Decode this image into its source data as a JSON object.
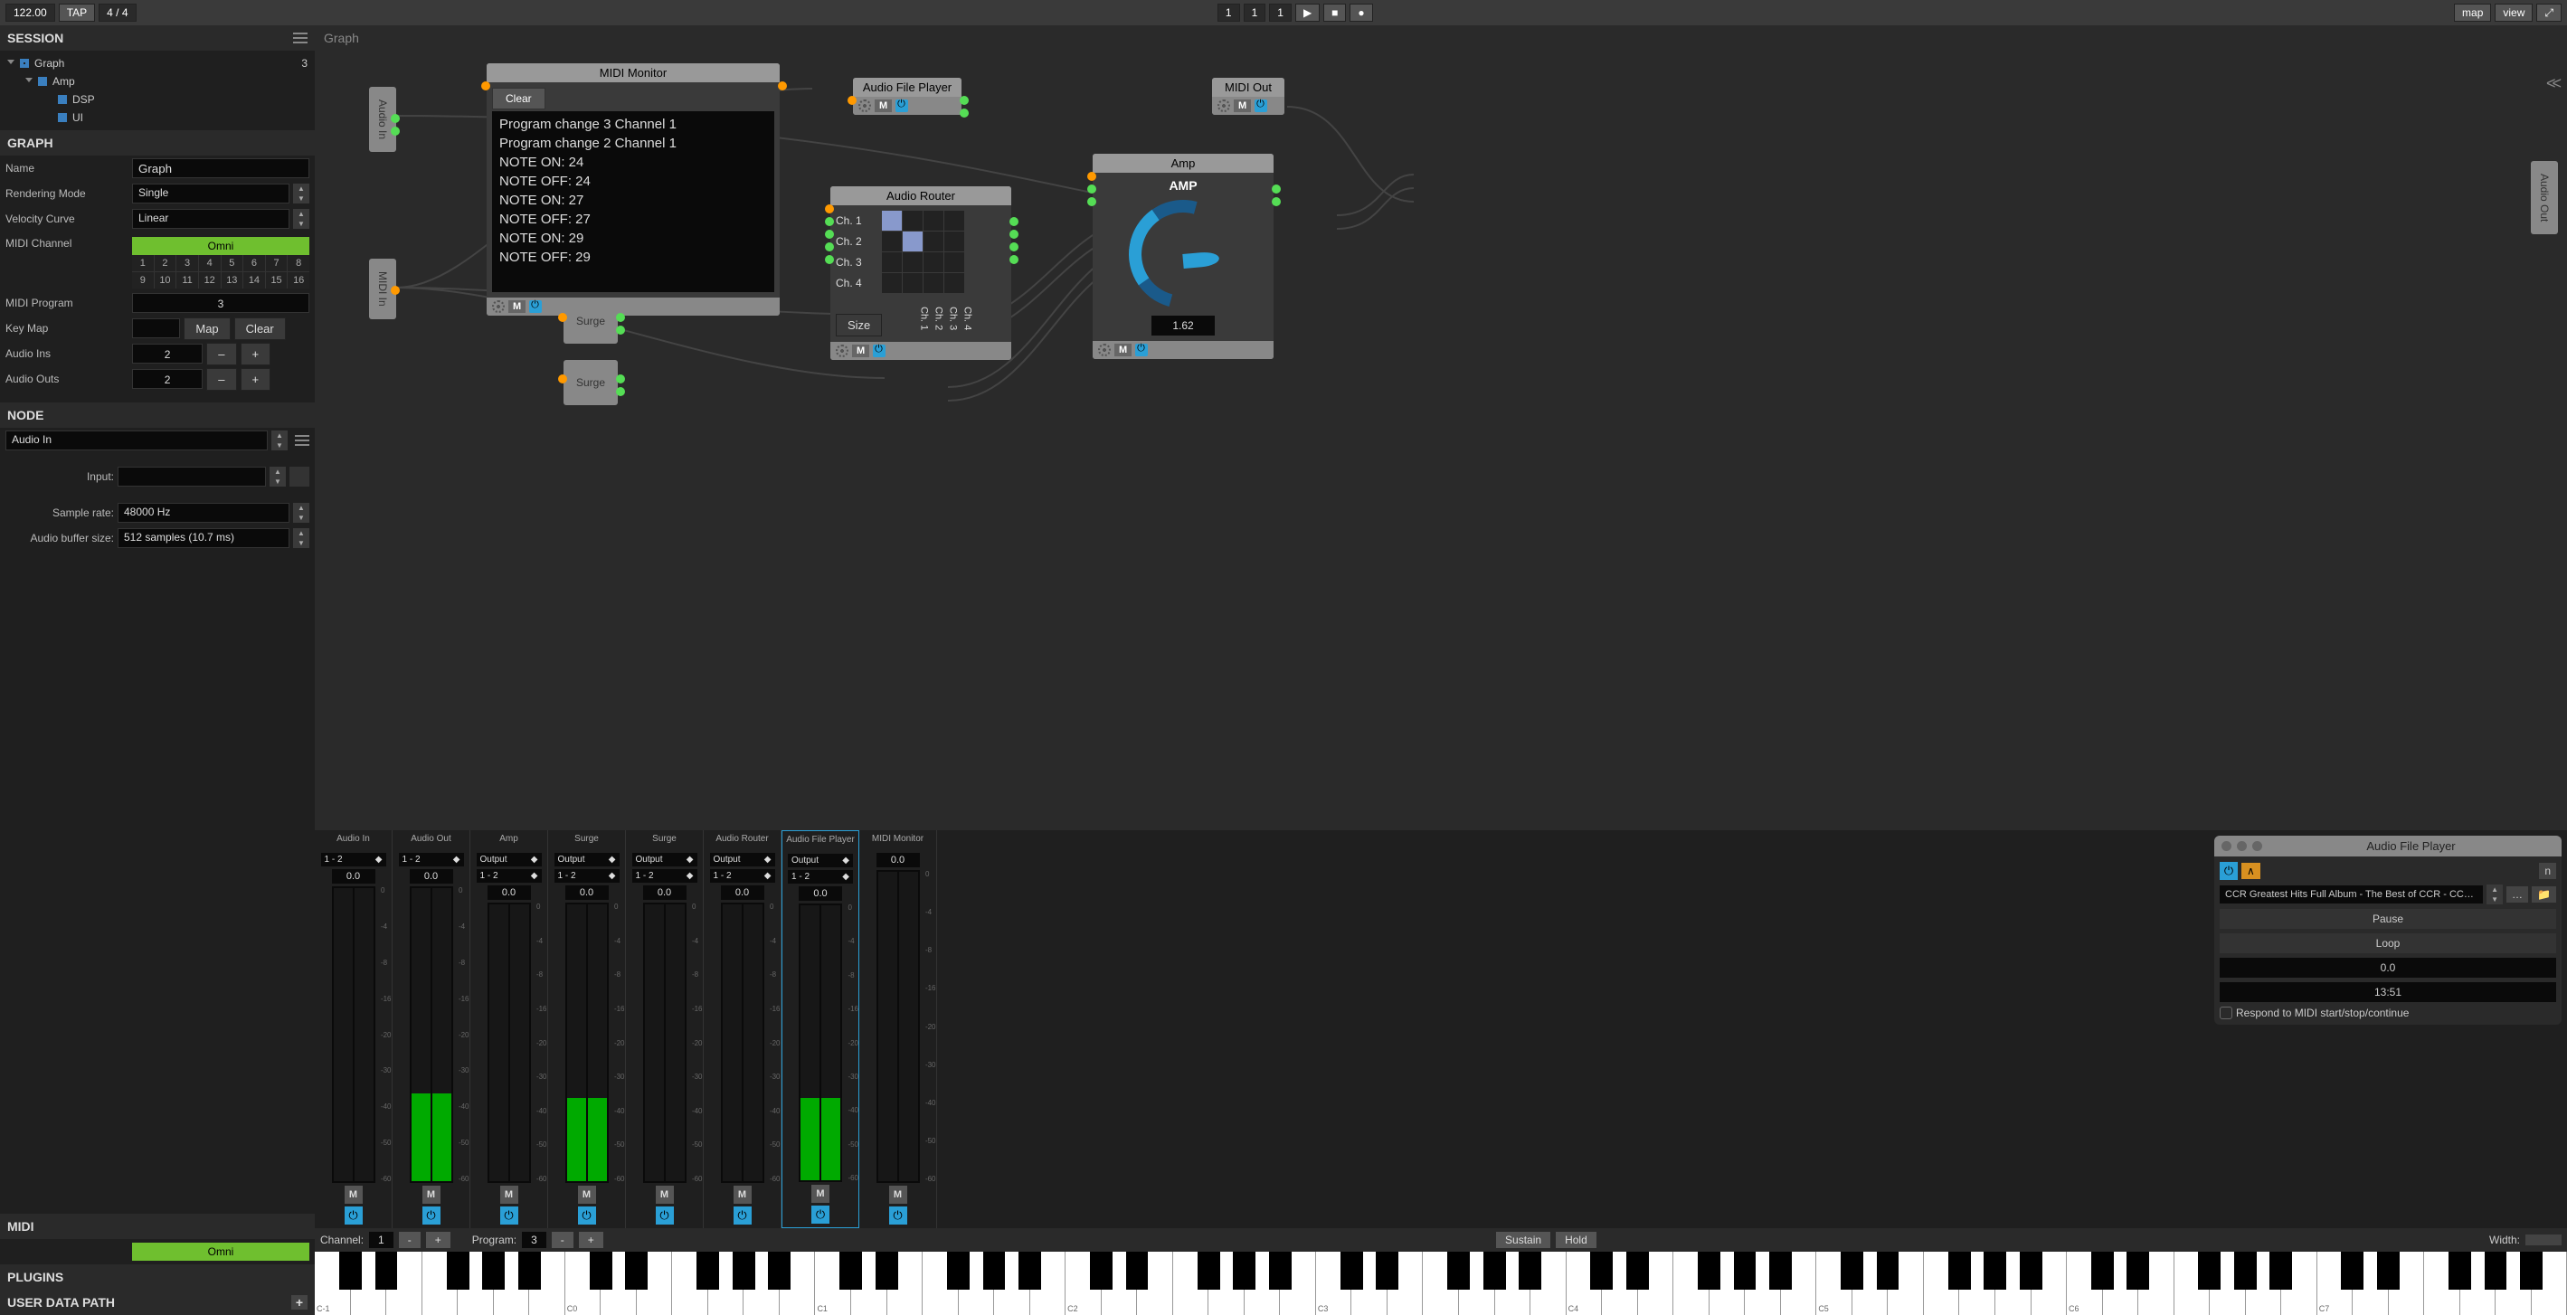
{
  "toolbar": {
    "tempo": "122.00",
    "tap": "TAP",
    "timesig": "4 / 4",
    "transport": [
      "1",
      "1",
      "1"
    ],
    "map": "map",
    "view": "view"
  },
  "session": {
    "header": "SESSION",
    "tree": [
      {
        "label": "Graph",
        "count": "3",
        "indent": 0,
        "icon": "grid"
      },
      {
        "label": "Amp",
        "indent": 1,
        "icon": "solid"
      },
      {
        "label": "DSP",
        "indent": 2,
        "icon": "solid"
      },
      {
        "label": "UI",
        "indent": 2,
        "icon": "solid"
      }
    ]
  },
  "graph_props": {
    "header": "GRAPH",
    "name_lbl": "Name",
    "name": "Graph",
    "render_lbl": "Rendering Mode",
    "render": "Single",
    "vel_lbl": "Velocity Curve",
    "vel": "Linear",
    "midich_lbl": "MIDI Channel",
    "omni": "Omni",
    "channels": [
      "1",
      "2",
      "3",
      "4",
      "5",
      "6",
      "7",
      "8",
      "9",
      "10",
      "11",
      "12",
      "13",
      "14",
      "15",
      "16"
    ],
    "midip_lbl": "MIDI Program",
    "midip": "3",
    "keymap_lbl": "Key Map",
    "map_btn": "Map",
    "clear_btn": "Clear",
    "ains_lbl": "Audio Ins",
    "ains": "2",
    "aouts_lbl": "Audio Outs",
    "aouts": "2",
    "minus": "–",
    "plus": "+"
  },
  "node_props": {
    "header": "NODE",
    "selected": "Audio In",
    "input_lbl": "Input:",
    "sr_lbl": "Sample rate:",
    "sr": "48000 Hz",
    "buf_lbl": "Audio buffer size:",
    "buf": "512 samples (10.7 ms)"
  },
  "midi_sec": {
    "header": "MIDI",
    "omni": "Omni"
  },
  "plugins_sec": {
    "header": "PLUGINS"
  },
  "userpath_sec": {
    "header": "USER DATA PATH"
  },
  "graph_canvas": {
    "title": "Graph",
    "collapse": "<<",
    "audio_in": "Audio In",
    "midi_in": "MIDI In",
    "audio_out": "Audio Out",
    "midi_out": "MIDI Out",
    "monitor": {
      "title": "MIDI Monitor",
      "clear": "Clear",
      "log": [
        "Program change 3 Channel 1",
        "Program change 2 Channel 1",
        "NOTE ON: 24",
        "NOTE OFF: 24",
        "NOTE ON: 27",
        "NOTE OFF: 27",
        "NOTE ON: 29",
        "NOTE OFF: 29"
      ]
    },
    "surge1": "Surge",
    "surge2": "Surge",
    "afp": {
      "title": "Audio File Player"
    },
    "router": {
      "title": "Audio Router",
      "rows": [
        "Ch. 1",
        "Ch. 2",
        "Ch. 3",
        "Ch. 4"
      ],
      "cols": [
        "Ch. 1",
        "Ch. 2",
        "Ch. 3",
        "Ch. 4"
      ],
      "size": "Size",
      "matrix": [
        [
          1,
          0,
          0,
          0
        ],
        [
          0,
          1,
          0,
          0
        ],
        [
          0,
          0,
          0,
          0
        ],
        [
          0,
          0,
          0,
          0
        ]
      ]
    },
    "amp": {
      "title": "Amp",
      "label": "AMP",
      "value": "1.62"
    },
    "m": "M"
  },
  "mixer": {
    "strips": [
      {
        "name": "Audio In",
        "out": "1 - 2",
        "gain": "0.0",
        "level": 0
      },
      {
        "name": "Audio Out",
        "out": "1 - 2",
        "gain": "0.0",
        "level": 30
      },
      {
        "name": "Amp",
        "bus": "Output",
        "out": "1 - 2",
        "gain": "0.0",
        "level": 0
      },
      {
        "name": "Surge",
        "bus": "Output",
        "out": "1 - 2",
        "gain": "0.0",
        "level": 30
      },
      {
        "name": "Surge",
        "bus": "Output",
        "out": "1 - 2",
        "gain": "0.0",
        "level": 0
      },
      {
        "name": "Audio Router",
        "bus": "Output",
        "out": "1 - 2",
        "gain": "0.0",
        "level": 0
      },
      {
        "name": "Audio File Player",
        "bus": "Output",
        "out": "1 - 2",
        "gain": "0.0",
        "level": 30,
        "selected": true
      },
      {
        "name": "MIDI Monitor",
        "gain": "0.0",
        "level": 0
      }
    ],
    "output_lbl": "Output",
    "m": "M"
  },
  "kbd": {
    "channel_lbl": "Channel:",
    "channel": "1",
    "program_lbl": "Program:",
    "program": "3",
    "sustain": "Sustain",
    "hold": "Hold",
    "width_lbl": "Width:",
    "minus": "-",
    "plus": "+",
    "octaves": [
      "C-1",
      "C0",
      "C1",
      "C2",
      "C3",
      "C4",
      "C5",
      "C6",
      "C7"
    ]
  },
  "player": {
    "title": "Audio File Player",
    "n": "n",
    "file": "CCR Greatest Hits Full Album - The Best of CCR - CCR Love Songs Ever [-UX...",
    "pause": "Pause",
    "loop": "Loop",
    "pos": "0.0",
    "dur": "13:51",
    "respond": "Respond to MIDI start/stop/continue",
    "caret": "∧",
    "dots": "…",
    "folder": "📁"
  }
}
